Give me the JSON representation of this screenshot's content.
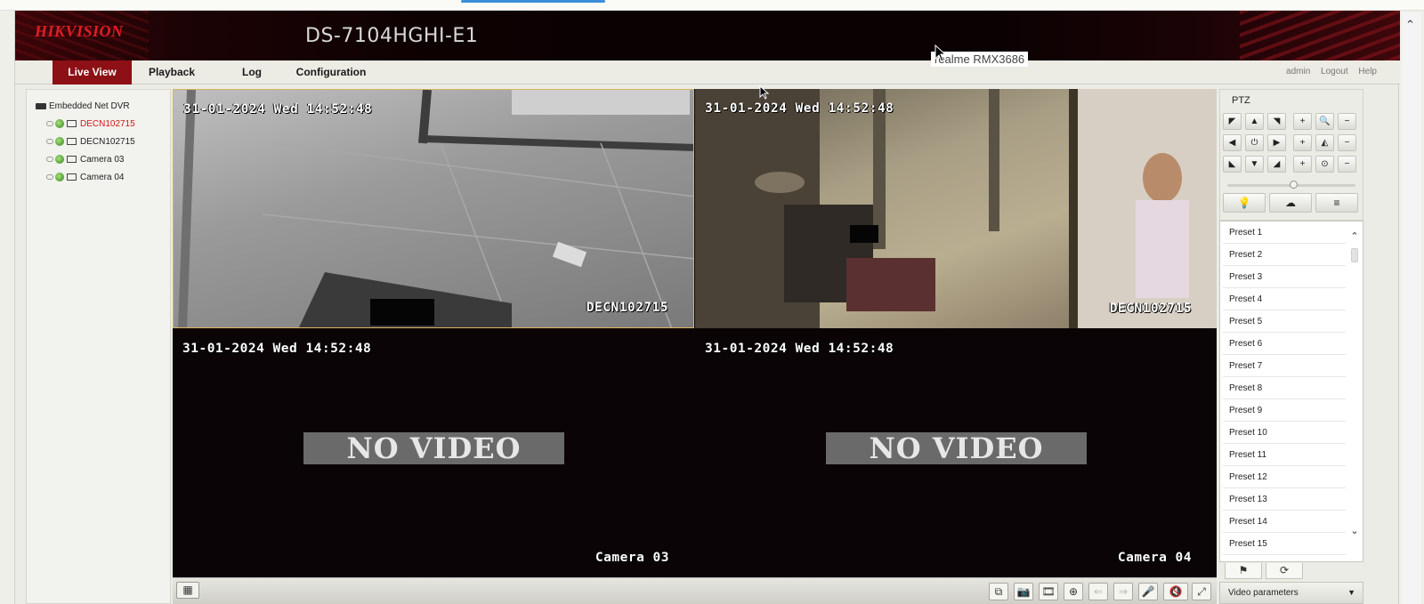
{
  "header": {
    "logo": "HIKVISION",
    "model": "DS-7104HGHI-E1"
  },
  "menu": [
    {
      "label": "Live View",
      "active": true
    },
    {
      "label": "Playback",
      "active": false
    },
    {
      "label": "Log",
      "active": false
    },
    {
      "label": "Configuration",
      "active": false
    }
  ],
  "device_tag": "realme RMX3686",
  "user_links": {
    "admin": "admin",
    "logout": "Logout",
    "help": "Help"
  },
  "tree": {
    "root": "Embedded Net DVR",
    "items": [
      {
        "label": "DECN102715",
        "selected": true
      },
      {
        "label": "DECN102715",
        "selected": false
      },
      {
        "label": "Camera 03",
        "selected": false
      },
      {
        "label": "Camera 04",
        "selected": false
      }
    ]
  },
  "tiles": [
    {
      "time": "31-01-2024 Wed 14:52:48",
      "name": "DECN102715",
      "no_video": ""
    },
    {
      "time": "31-01-2024 Wed 14:52:48",
      "name": "DECN102715",
      "no_video": ""
    },
    {
      "time": "31-01-2024 Wed 14:52:48",
      "name": "Camera 03",
      "no_video": "NO VIDEO"
    },
    {
      "time": "31-01-2024 Wed 14:52:48",
      "name": "Camera 04",
      "no_video": "NO VIDEO"
    }
  ],
  "ptz": {
    "title": "PTZ",
    "buttons": [
      "◤",
      "▲",
      "◥",
      "+",
      "🔍",
      "−",
      "◀",
      "⏻",
      "▶",
      "+",
      "◭",
      "−",
      "◣",
      "▼",
      "◢",
      "+",
      "⊙",
      "−"
    ],
    "wide_buttons": [
      "💡",
      "☁",
      "≡"
    ]
  },
  "presets": [
    "Preset 1",
    "Preset 2",
    "Preset 3",
    "Preset 4",
    "Preset 5",
    "Preset 6",
    "Preset 7",
    "Preset 8",
    "Preset 9",
    "Preset 10",
    "Preset 11",
    "Preset 12",
    "Preset 13",
    "Preset 14",
    "Preset 15"
  ],
  "preset_tabs": [
    "⚑",
    "⟳"
  ],
  "video_params": "Video parameters",
  "bottom_tools": [
    "⧉",
    "📷",
    "🎞",
    "⊕",
    "⇐",
    "⇒",
    "🎤",
    "🔇",
    "⤢"
  ],
  "layout_button": "▦",
  "colors": {
    "accent": "#8c1015",
    "brand_red": "#e01d25",
    "selected_camera": "#d3141a"
  }
}
